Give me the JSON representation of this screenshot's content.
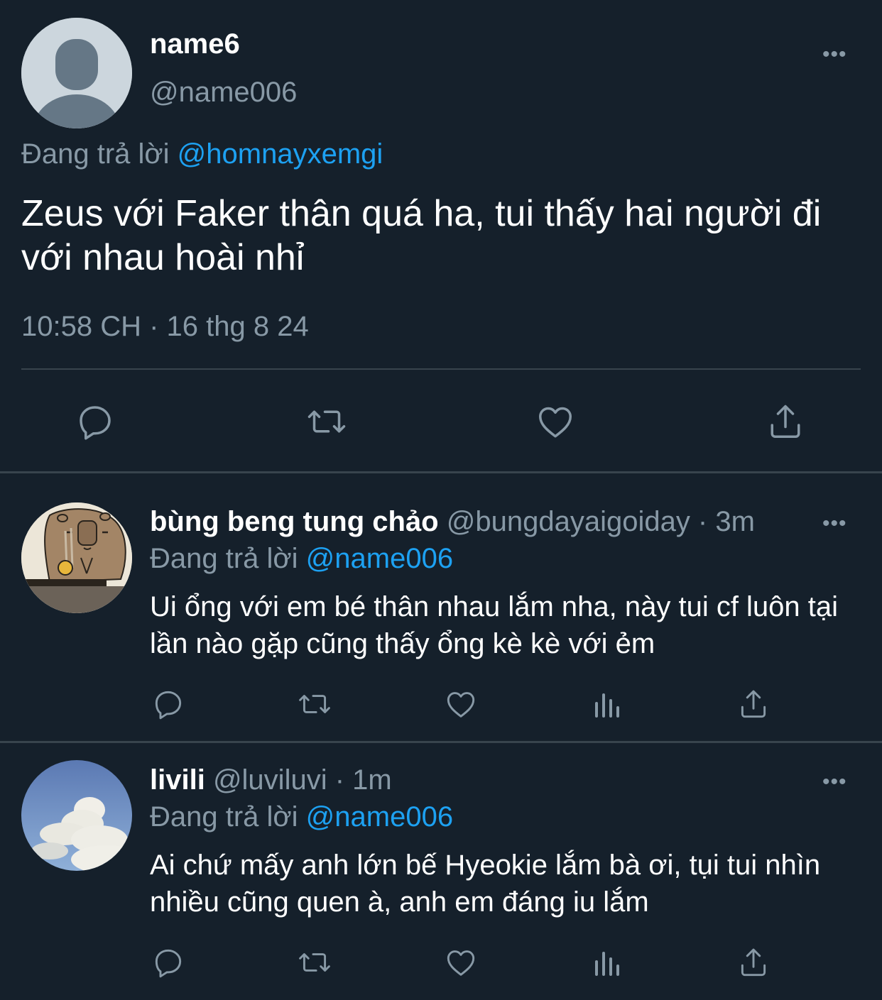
{
  "main_tweet": {
    "name": "name6",
    "handle": "@name006",
    "replying_prefix": "Đang trả lời",
    "replying_to": "@homnayxemgi",
    "text": "Zeus với Faker thân quá ha, tui thấy hai người đi với nhau hoài nhỉ",
    "timestamp": "10:58 CH · 16 thg 8 24",
    "more_label": "•••"
  },
  "replies": [
    {
      "name": "bùng beng tung chảo",
      "meta": "@bungdayaigoiday · 3m",
      "replying_prefix": "Đang trả lời",
      "replying_to": "@name006",
      "text": "Ui ổng với em bé thân nhau lắm nha, này tui cf luôn tại lần nào gặp cũng thấy ổng kè kè với ẻm",
      "more_label": "•••"
    },
    {
      "name": "livili",
      "meta": "@luviluvi · 1m",
      "replying_prefix": "Đang trả lời",
      "replying_to": "@name006",
      "text": "Ai chứ mấy anh lớn bế Hyeokie lắm bà ơi, tụi tui nhìn nhiều cũng quen à, anh em đáng iu lắm",
      "more_label": "•••"
    }
  ],
  "icons": [
    "reply-icon",
    "retweet-icon",
    "like-icon",
    "analytics-icon",
    "share-icon",
    "more-icon"
  ],
  "colors": {
    "background": "#15202b",
    "accent": "#1da1f2",
    "muted": "#8899a6",
    "divider": "#38444d"
  }
}
